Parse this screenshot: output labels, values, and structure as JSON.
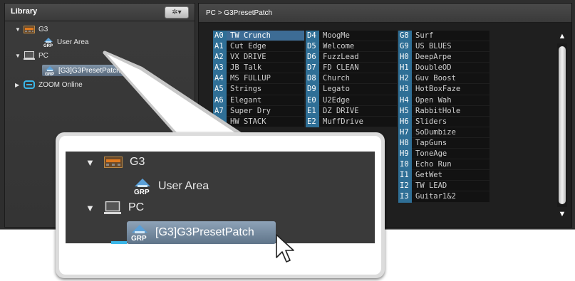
{
  "library": {
    "title": "Library",
    "gear_glyph": "✲▾",
    "tree": [
      {
        "label": "G3",
        "icon": "device-g3-icon",
        "expanded": true
      },
      {
        "label": "User Area",
        "icon": "group-grp-icon"
      },
      {
        "label": "PC",
        "icon": "computer-icon",
        "expanded": true
      },
      {
        "label": "[G3]G3PresetPatch",
        "icon": "group-grp-icon",
        "selected": true
      },
      {
        "label": "ZOOM Online",
        "icon": "zoom-online-icon",
        "expanded": false
      }
    ]
  },
  "breadcrumb": "PC > G3PresetPatch",
  "patches": {
    "columns": [
      [
        {
          "id": "A0",
          "name": "TW Crunch",
          "active": true
        },
        {
          "id": "A1",
          "name": "Cut Edge"
        },
        {
          "id": "A2",
          "name": "VX DRIVE"
        },
        {
          "id": "A3",
          "name": "JB Talk"
        },
        {
          "id": "A4",
          "name": "MS FULLUP"
        },
        {
          "id": "A5",
          "name": "Strings"
        },
        {
          "id": "A6",
          "name": "Elegant"
        },
        {
          "id": "A7",
          "name": "Super Dry"
        },
        {
          "id": "",
          "name": "HW STACK"
        }
      ],
      [
        {
          "id": "D4",
          "name": "MoogMe"
        },
        {
          "id": "D5",
          "name": "Welcome"
        },
        {
          "id": "D6",
          "name": "FuzzLead"
        },
        {
          "id": "D7",
          "name": "FD CLEAN"
        },
        {
          "id": "D8",
          "name": "Church"
        },
        {
          "id": "D9",
          "name": "Legato"
        },
        {
          "id": "E0",
          "name": "U2Edge"
        },
        {
          "id": "E1",
          "name": "DZ DRIVE"
        },
        {
          "id": "E2",
          "name": "MuffDrive"
        }
      ],
      [
        {
          "id": "G8",
          "name": "Surf"
        },
        {
          "id": "G9",
          "name": "US BLUES"
        },
        {
          "id": "H0",
          "name": "DeepArpe"
        },
        {
          "id": "H1",
          "name": "DoubleOD"
        },
        {
          "id": "H2",
          "name": "Guv Boost"
        },
        {
          "id": "H3",
          "name": "HotBoxFaze"
        },
        {
          "id": "H4",
          "name": "Open Wah"
        },
        {
          "id": "H5",
          "name": "RabbitHole"
        },
        {
          "id": "H6",
          "name": "Sliders"
        },
        {
          "id": "H7",
          "name": "SoDumbize"
        },
        {
          "id": "H8",
          "name": "TapGuns"
        },
        {
          "id": "H9",
          "name": "ToneAge"
        },
        {
          "id": "I0",
          "name": "Echo Run"
        },
        {
          "id": "I1",
          "name": "GetWet"
        },
        {
          "id": "I2",
          "name": "TW LEAD"
        },
        {
          "id": "I3",
          "name": "Guitar1&2"
        }
      ]
    ]
  },
  "zoom": {
    "g3": "G3",
    "user_area": "User Area",
    "pc": "PC",
    "preset_patch": "[G3]G3PresetPatch",
    "grp_text": "GRP"
  },
  "scrollbar": {
    "up": "▲",
    "down": "▼"
  },
  "colors": {
    "accent": "#2f6f96",
    "selection": "#3d6c95"
  }
}
